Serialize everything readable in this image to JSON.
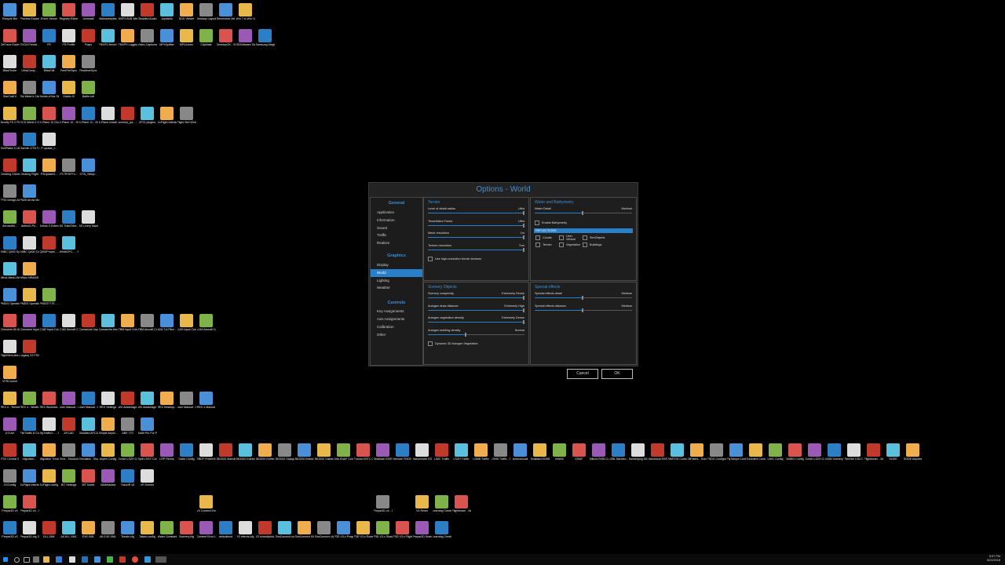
{
  "desktop_rows": [
    [
      "Recycle Bin",
      "Process Explorer",
      "Event Viewer",
      "Registry Editor",
      "Uninstall",
      "Malwarebytes",
      "MSFS AVB WebUI Setup",
      "Disabled Audio",
      "Joysticks",
      "DDS Viewer",
      "Desktop Layout",
      "Remember Me",
      "Win 7 to Win 10 Migration"
    ],
    [
      "GeForce Experience",
      "EVGA Precisi...",
      "FR",
      "FR Profile",
      "Fraps",
      "FRAPS Bench Viewer",
      "FRAPS Logging",
      "Video Captures",
      "MP4Splitter",
      "MP4Joiner",
      "ClipMate",
      "DesktopOK - Shortcut",
      "SDSoftware Sandra P...",
      "Samsung Magician"
    ],
    [
      "BlissFinder",
      "UltraComp...",
      "BlissEdit",
      "FreeFileSync",
      "RealtimeSync"
    ],
    [
      "StarCraft II",
      "Sid Meier's Civilization VI",
      "Ashes of the Singularity",
      "Diablo III",
      "Battle.net"
    ],
    [
      "Aerofly FS 2 Flight Sim...",
      "DCS World 2 OpenAlpha",
      "X-Plane 10 Global -...",
      "X-Plane 10 - Shortcut",
      "X-Plane 11 - Shortcut",
      "X-Plane Install...",
      "scenery_pa... - Shortcut",
      "XP11 plugins",
      "XxFlight Interface 7...",
      "Flight Sim World"
    ],
    [
      "SimPlates X Ultra",
      "Garmin GTN Trainer",
      "P update_t...",
      ""
    ],
    [
      "Creating Checklist fr...",
      "Creating Flight Pla...",
      "P3Update3...",
      "P17R70FFo...",
      "GTN_Setup..."
    ],
    [
      "FFDI Design Airbus FM...",
      "PA28 Arrow Model Sou..."
    ],
    [
      "AerosoftA...",
      "AirbusX-Pu...",
      "Airbus X Extend...",
      "AS TrainOrbe...",
      "AS Livery Manager"
    ],
    [
      "iNIBC Q400 System",
      "iNIBC Q400 Config",
      "Q400Propel... - Shortcut",
      "WhiteOFC... - Shortcut"
    ],
    [
      "Milviz Menu Manager",
      "Milviz NRAMS"
    ],
    [
      "PMDG Operatio...",
      "PMDG Operatio...",
      "PMDG777E... - Shortcut"
    ],
    [
      "Cherokee 80 Aircraft Co...",
      "Cherokee Input Conf...",
      "C182 Input Configurator",
      "C182 Aircraft Configurator",
      "Comanche Input Conf...",
      "Comanche Aircraft Co...",
      "TBM Input Configurator",
      "TBM Aircraft Configurator",
      "A2A T-6 Pilot...",
      "L049 Input Configurator",
      "L049 Aircraft Configurator"
    ],
    [
      "FlightSimLabs A2 FS320 Co...",
      "Legacy X2 FSIS Config"
    ],
    [
      "VFRControl"
    ],
    [
      "REX 4 - Texture Di...",
      "REX 4 - Weath...",
      "REX WorldwA...",
      "User Manual - WX Adva...",
      "User Manual - REX 4 Wa...",
      "REX Settings",
      "WX Advantage...",
      "WX Advantage R...",
      "REX Desktop...",
      "User Manual - REX Worl...",
      "REX 4 Manual"
    ],
    [
      "UTLive",
      "FileTraffic 8 Connect",
      "MyTrafficX... - Shortcut",
      "AFCAD",
      "Disabled AFCAD",
      "Simple Airpor...",
      "ABE 770",
      "Addit Pro For Prepar3D"
    ],
    [
      "FSX Central 3",
      "migration...",
      "Migration Trouble...",
      "Orbx - Shortcut",
      "Simulator - Shortcut",
      "Aspen Config",
      "Zurich LSZH Config",
      "Split LSGY Config",
      "LRP Renns",
      "Gatto Config",
      "EBDF FreshKit",
      "BK2000 Aberde...",
      "BK2000 Edinburgh",
      "BK2000 Exeter",
      "BK2000 Glasgow",
      "BK2000 Bristol",
      "BK2000 Gatwick",
      "Alta KNAF Config",
      "Fumoa KNTC Config",
      "Sealtown EKEH Config",
      "Benone FNCB Config",
      "Manchester EGCC Config",
      "LIMC Traffic",
      "LSZH Traffic",
      "LSMB Traffic",
      "LSHB Traffic - Shortcut",
      "Anteroliccall",
      "Svalbard ENSB Config",
      "InWAK",
      "KSMF",
      "Billund EKBI Config",
      "LEBL Barcelo...",
      "Sandefjong EKCB Config",
      "Barcelona EKRM Config",
      "SIMTOD Control Pa...",
      "ZilFaters - Scenery Co...",
      "FSDG Configurator",
      "FlyTampa Configurator",
      "Turbulent Console...",
      "LIMC Config",
      "WABO Config",
      "Zurich LSZH Config",
      "XUMI Scenery Co...",
      "ReoSim KSLC Config",
      "Flightbeam - Manager C...",
      "SODE",
      "SODE Airports"
    ],
    [
      "GXConfig",
      "EzFlight Interfa...",
      "EzFlight config files",
      "BIT Settings",
      "BIT Notes",
      "VAMetadata",
      "TrackIR v5",
      "VR Entries"
    ],
    [
      "Prepar3D v4",
      "Prepar3D v4 - Shortcut",
      "",
      "",
      "",
      "",
      "",
      "",
      "",
      "",
      "V4 Content Errors",
      "",
      "",
      "",
      "",
      "",
      "",
      "",
      "",
      "Prepar3D v4 - Shortcut",
      "",
      "V4 Reset",
      "Learning Center.ch...",
      "Flightbeam - Manager Cu..."
    ],
    [
      "Prepar3D v3",
      "Prepar3D.cfg 3.4 - 18466",
      "DLL.XML",
      "Alt DLL.XML",
      "EXE.XML",
      "Alt EXE.XML",
      "Terrain.cfg",
      "Tatam.config",
      "Water Constants V3",
      "Scenery.cfg",
      "Content Error Log",
      "defaultcmd",
      "V3 effects.cfg",
      "V3 shmobjects...",
      "SimConnect.xml",
      "SimConnect INI Logging",
      "SimConnect cfg for IR",
      "P3D V3.x ProgramData",
      "P3D V3.x Roaming",
      "P3D V3.x Shaders",
      "P3D V3.x Flight Files",
      "Prepar3D Notes",
      "Learning Center"
    ]
  ],
  "dialog": {
    "title": "Options - World",
    "nav": {
      "general_header": "General",
      "general_items": [
        "Application",
        "Information",
        "Sound",
        "Traffic",
        "Realism"
      ],
      "graphics_header": "Graphics",
      "graphics_items": [
        "Display",
        "World",
        "Lighting",
        "Weather"
      ],
      "active_item": "World",
      "controls_header": "Controls",
      "controls_items": [
        "Key Assignments",
        "Axis Assignments",
        "Calibration",
        "Other"
      ]
    },
    "terrain": {
      "header": "Terrain",
      "settings": [
        {
          "label": "Level of detail radius",
          "value": "Ultra",
          "level": 1.0
        },
        {
          "label": "Tessellation Factor",
          "value": "Ultra",
          "level": 1.0
        },
        {
          "label": "Mesh resolution",
          "value": "1m",
          "level": 1.0
        },
        {
          "label": "Texture resolution",
          "value": "7cm",
          "level": 1.0
        }
      ],
      "checkbox": "Use high-resolution terrain textures"
    },
    "water": {
      "header": "Water and Bathymetry",
      "settings": [
        {
          "label": "Water Detail",
          "value": "Medium",
          "level": 0.5
        }
      ],
      "checkbox": "Enable Bathymetry",
      "reflections_header": "REFLECTIONS",
      "reflections": [
        "Clouds",
        "User Vehicle",
        "SimObjects",
        "Terrain",
        "Vegetation",
        "Buildings"
      ]
    },
    "scenery": {
      "header": "Scenery Objects",
      "settings": [
        {
          "label": "Scenery complexity",
          "value": "Extremely Dense",
          "level": 1.0
        },
        {
          "label": "Autogen draw distance",
          "value": "Extremely High",
          "level": 1.0
        },
        {
          "label": "Autogen vegetation density",
          "value": "Extremely Dense",
          "level": 1.0
        },
        {
          "label": "Autogen building density",
          "value": "Normal",
          "level": 0.4
        }
      ],
      "checkbox": "Dynamic 3D Autogen Vegetation"
    },
    "effects": {
      "header": "Special effects",
      "settings": [
        {
          "label": "Special effects detail",
          "value": "Medium",
          "level": 0.5
        },
        {
          "label": "Special effects distance",
          "value": "Medium",
          "level": 0.5
        }
      ]
    },
    "cancel_label": "Cancel",
    "ok_label": "OK"
  },
  "taskbar": {
    "time": "5:57 PM",
    "date": "5/22/2018"
  },
  "colors": {
    "accent": "#2a7fc9",
    "title": "#3d8fd6",
    "background": "#000000"
  }
}
